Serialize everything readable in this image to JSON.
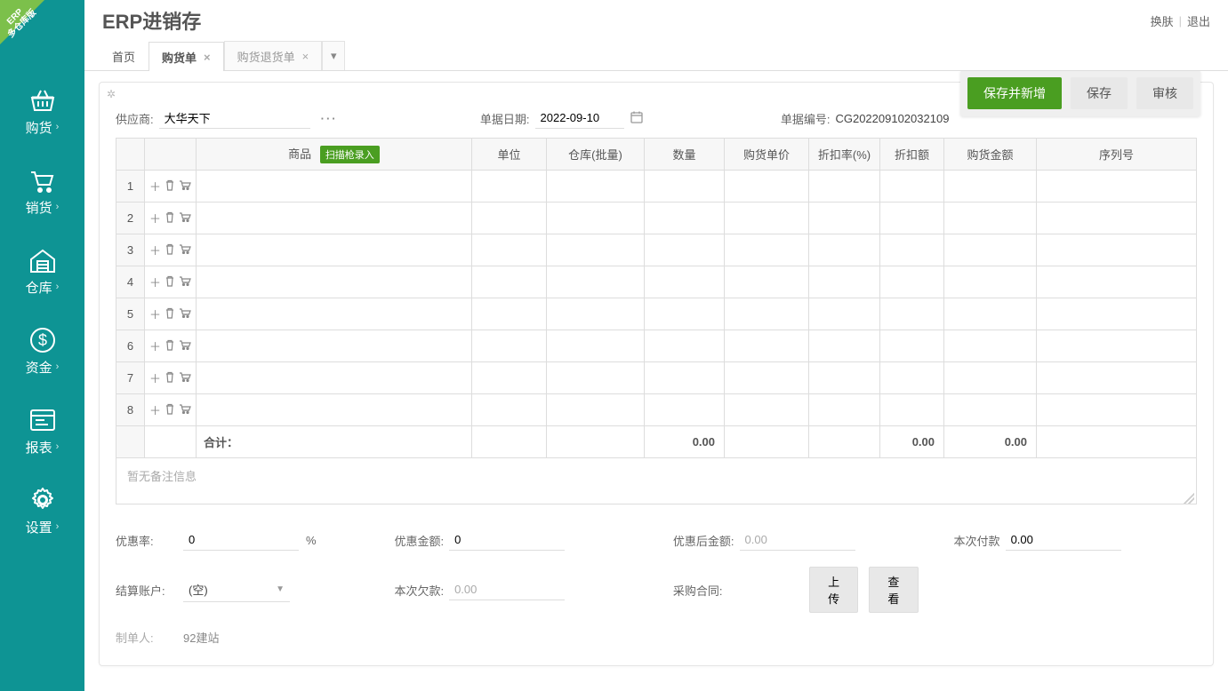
{
  "corner_banner": {
    "line1": "ERP",
    "line2": "多仓库版"
  },
  "app_title": "ERP进销存",
  "top_actions": {
    "theme": "换肤",
    "logout": "退出"
  },
  "nav": [
    {
      "id": "purchase",
      "label": "购货",
      "icon": "basket"
    },
    {
      "id": "sales",
      "label": "销货",
      "icon": "cart"
    },
    {
      "id": "warehouse",
      "label": "仓库",
      "icon": "warehouse"
    },
    {
      "id": "funds",
      "label": "资金",
      "icon": "money"
    },
    {
      "id": "reports",
      "label": "报表",
      "icon": "report"
    },
    {
      "id": "settings",
      "label": "设置",
      "icon": "gear"
    }
  ],
  "tabs": [
    {
      "id": "home",
      "label": "首页",
      "closable": false,
      "active": false
    },
    {
      "id": "purchase-order",
      "label": "购货单",
      "closable": true,
      "active": true
    },
    {
      "id": "purchase-return",
      "label": "购货退货单",
      "closable": true,
      "active": false
    }
  ],
  "actions": {
    "save_new": "保存并新增",
    "save": "保存",
    "audit": "审核"
  },
  "header_fields": {
    "supplier_label": "供应商:",
    "supplier_value": "大华天下",
    "date_label": "单据日期:",
    "date_value": "2022-09-10",
    "docno_label": "单据编号:",
    "docno_value": "CG202209102032109"
  },
  "columns": {
    "product": "商品",
    "scan_badge": "扫描枪录入",
    "unit": "单位",
    "warehouse": "仓库(批量)",
    "qty": "数量",
    "price": "购货单价",
    "discount_rate": "折扣率(%)",
    "discount_amt": "折扣额",
    "amount": "购货金额",
    "serial": "序列号"
  },
  "rows": [
    1,
    2,
    3,
    4,
    5,
    6,
    7,
    8
  ],
  "totals": {
    "label": "合计：",
    "qty": "0.00",
    "discount_amt": "0.00",
    "amount": "0.00"
  },
  "notes_placeholder": "暂无备注信息",
  "bottom": {
    "pref_rate_label": "优惠率:",
    "pref_rate_value": "0",
    "pref_rate_unit": "%",
    "pref_amt_label": "优惠金额:",
    "pref_amt_value": "0",
    "after_pref_label": "优惠后金额:",
    "after_pref_value": "0.00",
    "this_pay_label": "本次付款",
    "this_pay_value": "0.00",
    "account_label": "结算账户:",
    "account_value": "(空)",
    "this_owe_label": "本次欠款:",
    "this_owe_value": "0.00",
    "contract_label": "采购合同:",
    "upload_btn": "上传",
    "view_btn": "查看",
    "maker_label": "制单人:",
    "maker_value": "92建站"
  }
}
